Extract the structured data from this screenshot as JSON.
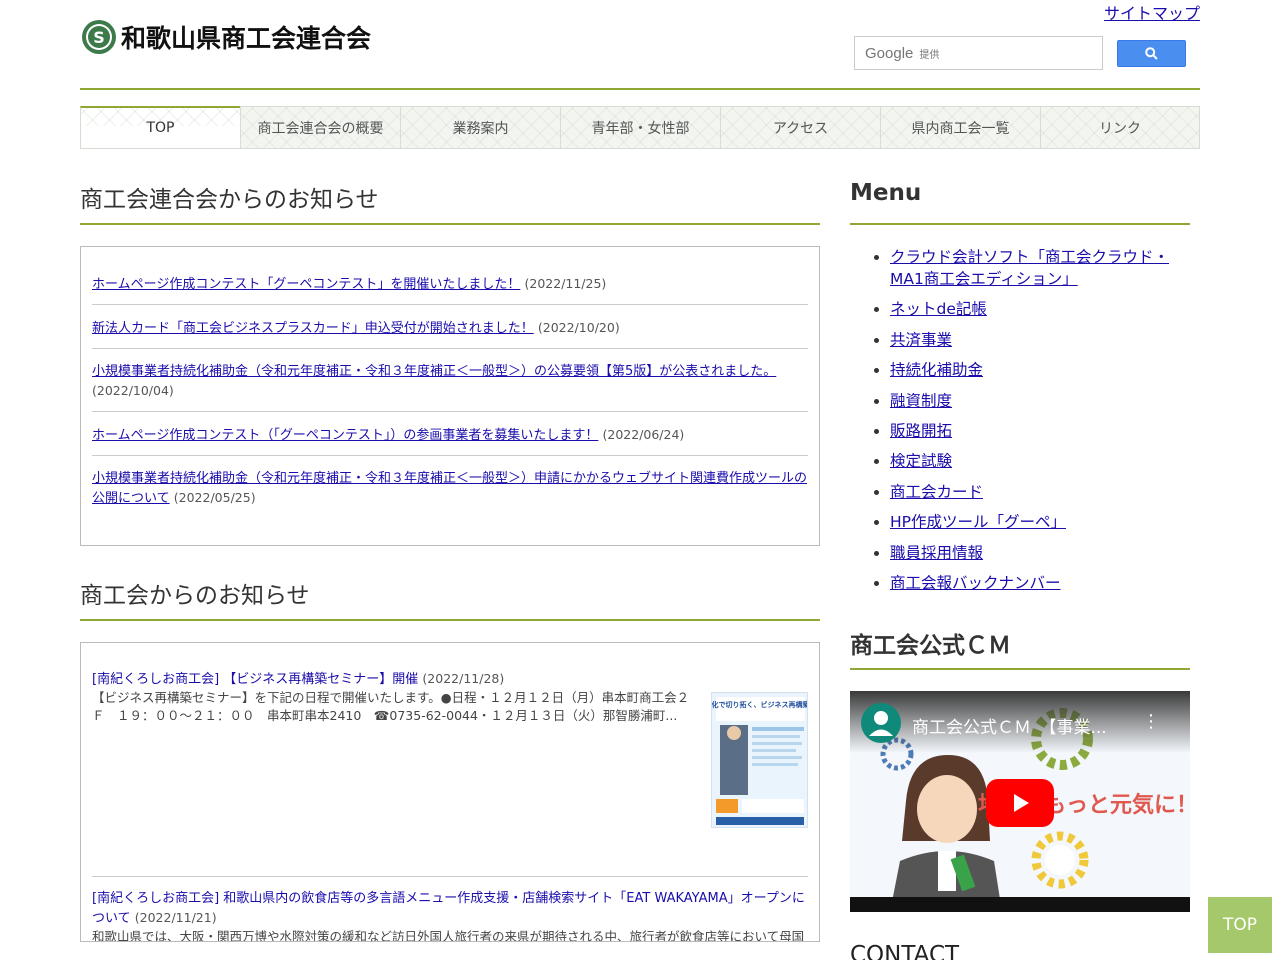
{
  "header": {
    "site_title": "和歌山県商工会連合会",
    "sitemap_label": "サイトマップ",
    "search": {
      "brand": "Google",
      "provided": "提供",
      "button_icon": "search-icon"
    }
  },
  "nav": {
    "items": [
      {
        "label": "TOP",
        "active": true
      },
      {
        "label": "商工会連合会の概要",
        "active": false
      },
      {
        "label": "業務案内",
        "active": false
      },
      {
        "label": "青年部・女性部",
        "active": false
      },
      {
        "label": "アクセス",
        "active": false
      },
      {
        "label": "県内商工会一覧",
        "active": false
      },
      {
        "label": "リンク",
        "active": false
      }
    ]
  },
  "federation_news": {
    "title": "商工会連合会からのお知らせ",
    "items": [
      {
        "text": "ホームページ作成コンテスト「グーペコンテスト」を開催いたしました！",
        "date": "(2022/11/25)"
      },
      {
        "text": "新法人カード「商工会ビジネスプラスカード」申込受付が開始されました！",
        "date": "(2022/10/20)"
      },
      {
        "text": "小規模事業者持続化補助金（令和元年度補正・令和３年度補正＜一般型＞）の公募要領【第5版】が公表されました。",
        "date": "(2022/10/04)"
      },
      {
        "text": "ホームページ作成コンテスト（「グーペコンテスト」）の参画事業者を募集いたします！",
        "date": "(2022/06/24)"
      },
      {
        "text": "小規模事業者持続化補助金（令和元年度補正・令和３年度補正＜一般型＞）申請にかかるウェブサイト関連費作成ツールの公開について",
        "date": "(2022/05/25)"
      }
    ]
  },
  "chamber_news": {
    "title": "商工会からのお知らせ",
    "items": [
      {
        "text": "[南紀くろしお商工会] 【ビジネス再構築セミナー】開催",
        "date": "(2022/11/28)",
        "excerpt": "【ビジネス再構築セミナー】を下記の日程で開催いたします。●日程・１２月１２日（月）串本町商工会２Ｆ　１９：００～２１：００　串本町串本2410　☎0735-62-0044・１２月１３日（火）那智勝浦町...",
        "thumb_text": "デジタル化で切り拓く、ビジネス再構築セミナー"
      },
      {
        "text": "[南紀くろしお商工会] 和歌山県内の飲食店等の多言語メニュー作成支援・店舗検索サイト「EAT WAKAYAMA」オープンについて",
        "date": "(2022/11/21)",
        "excerpt": "和歌山県では、大阪・関西万博や水際対策の緩和など訪日外国人旅行者の来県が期待される中、旅行者が飲食店等において母国語でストレスフリーに注文でき、さらに食事制限のあるインバウンド観光客も安心して食事でき..."
      }
    ]
  },
  "sidebar": {
    "menu_title": "Menu",
    "menu_items": [
      "クラウド会計ソフト「商工会クラウド・MA1商工会エディション」",
      "ネットde記帳",
      "共済事業",
      "持続化補助金",
      "融資制度",
      "販路開拓",
      "検定試験",
      "商工会カード",
      "HP作成ツール「グーペ」",
      "職員採用情報",
      "商工会報バックナンバー"
    ],
    "cm_title": "商工会公式ＣＭ",
    "video": {
      "title": "商工会公式ＣＭ　【事業...",
      "slogan": "地域をもっと元気に！"
    },
    "contact_title": "CONTACT"
  },
  "top_button": "TOP",
  "colors": {
    "accent": "#8fa835",
    "link": "#1a0dab",
    "top_button": "#a5c86a"
  }
}
